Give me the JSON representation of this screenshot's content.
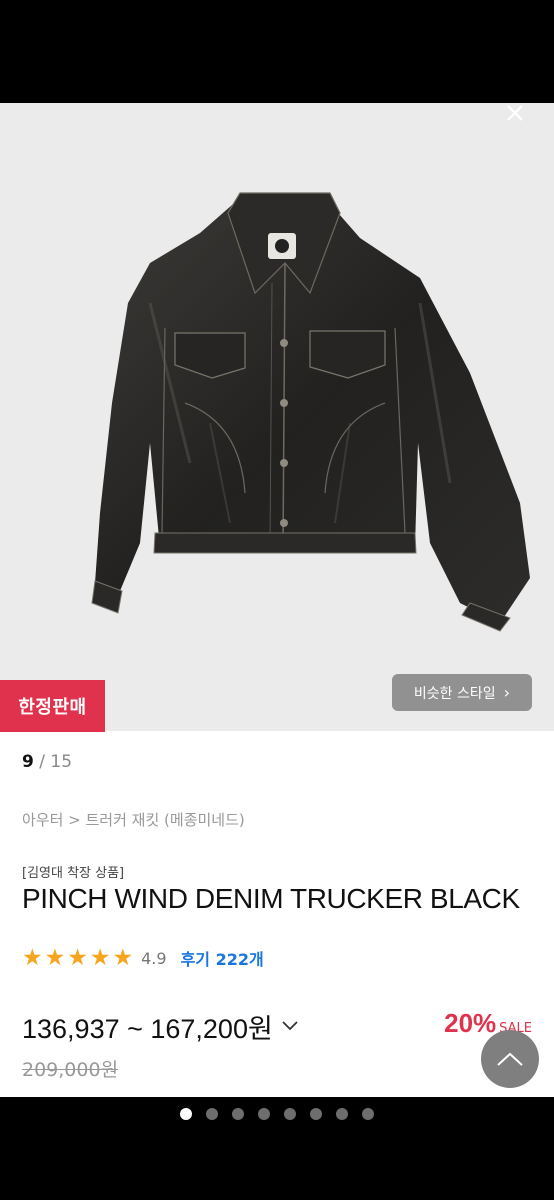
{
  "badges": {
    "limited_sale": "한정판매"
  },
  "similar_style": {
    "label": "비슷한 스타일",
    "chevron": "›"
  },
  "gallery": {
    "current": "9",
    "separator": " / ",
    "total": "15",
    "page_count": 8,
    "active_page": 1
  },
  "breadcrumb": "아우터 > 트러커 재킷 (메종미네드)",
  "product": {
    "tag": "[김영대 착장 상품]",
    "name": "PINCH WIND DENIM TRUCKER BLACK",
    "stars_filled": 5,
    "rating": "4.9",
    "reviews": "후기 222개",
    "price_range": "136,937 ~ 167,200원",
    "discount_percent": "20%",
    "sale_label": "SALE",
    "original_price": "209,000원"
  },
  "icons": {
    "close": "close-icon",
    "star": "star-icon",
    "chevron_down": "chevron-down-icon",
    "scroll_top": "chevron-up-icon"
  },
  "colors": {
    "accent_red": "#e0324c",
    "star": "#f7a51f",
    "review_link": "#1a75e0"
  }
}
